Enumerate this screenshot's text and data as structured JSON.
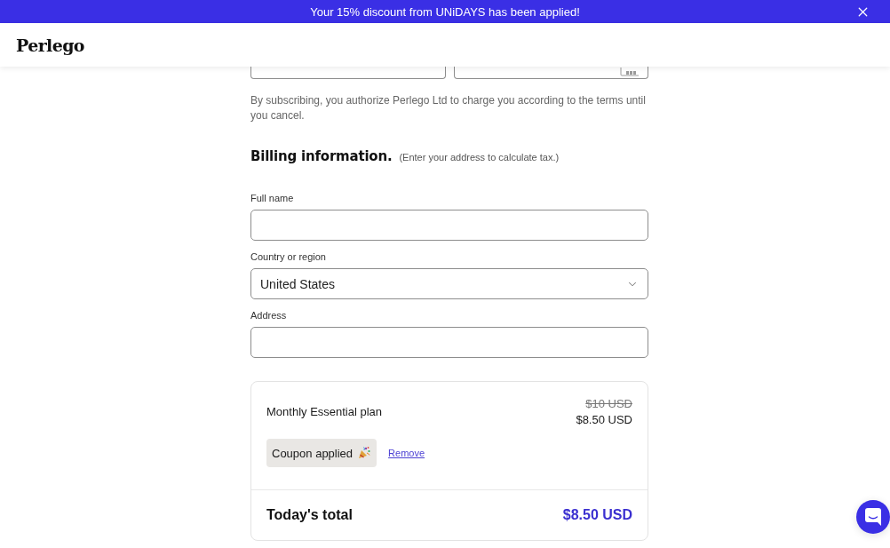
{
  "banner": {
    "message": "Your 15% discount from UNiDAYS has been applied!"
  },
  "header": {
    "logo": "Perlego"
  },
  "payment_fields": [
    {
      "kind": "plain"
    },
    {
      "kind": "cvc"
    }
  ],
  "terms": "By subscribing, you authorize Perlego Ltd to charge you according to the terms until you cancel.",
  "billing": {
    "title": "Billing information.",
    "hint": "(Enter your address to calculate tax.)",
    "fields": [
      {
        "label": "Full name",
        "kind": "text"
      },
      {
        "label": "Country or region",
        "kind": "select",
        "value": "United States"
      },
      {
        "label": "Address",
        "kind": "text"
      }
    ]
  },
  "summary": {
    "plan": "Monthly Essential plan",
    "original_price": "$10 USD",
    "price": "$8.50 USD",
    "coupon": {
      "label": "Coupon applied",
      "action": "Remove"
    },
    "total_label": "Today's total",
    "total": "$8.50 USD"
  }
}
